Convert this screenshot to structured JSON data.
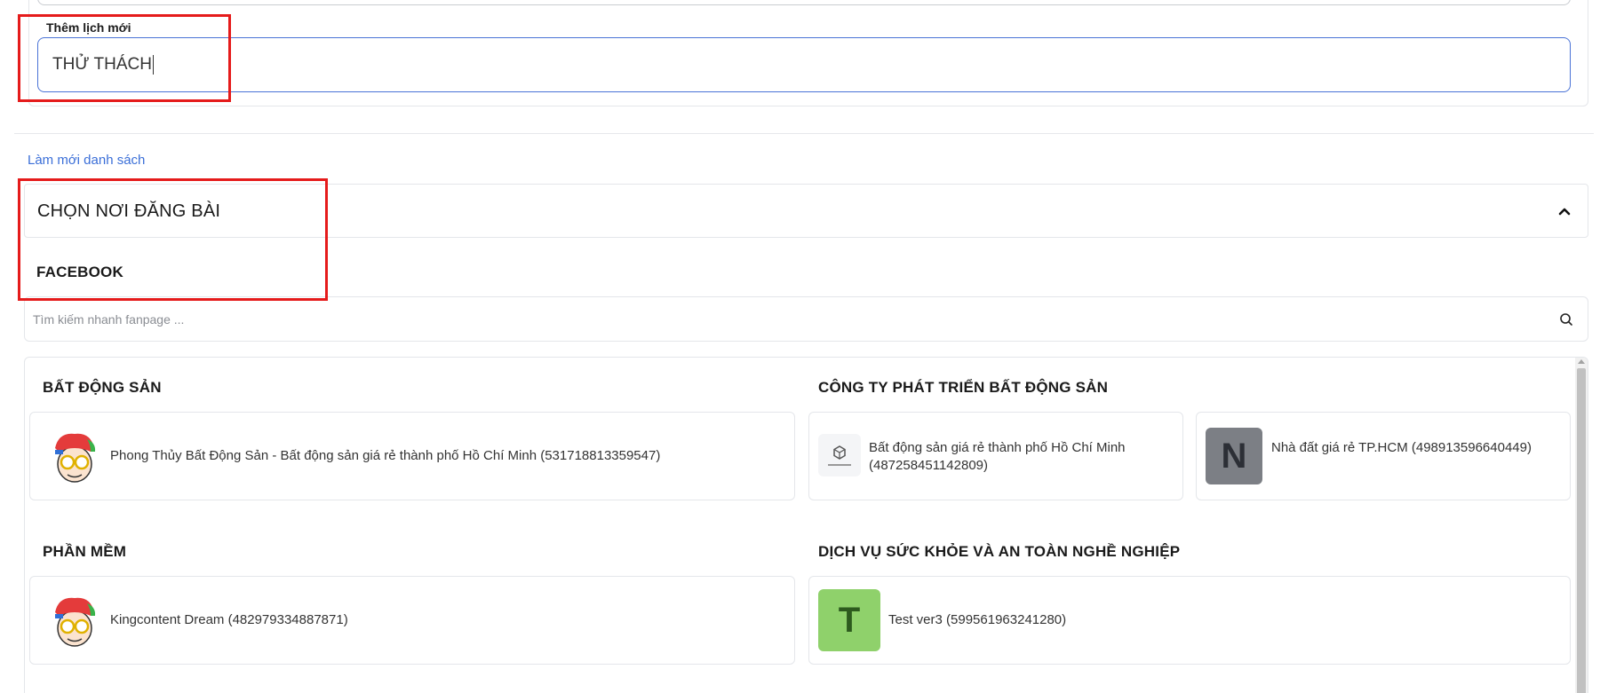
{
  "schedule": {
    "label": "Thêm lịch mới",
    "value": "THỬ THÁCH"
  },
  "refresh_link": "Làm mới danh sách",
  "section": {
    "title": "CHỌN NƠI ĐĂNG BÀI",
    "platform": "FACEBOOK"
  },
  "search": {
    "placeholder": "Tìm kiếm nhanh fanpage ..."
  },
  "categories": [
    {
      "title": "BẤT ĐỘNG SẢN",
      "pages": [
        {
          "name": "Phong Thủy Bất Động Sản - Bất động sản giá rẻ thành phố Hồ Chí Minh (531718813359547)"
        }
      ]
    },
    {
      "title": "CÔNG TY PHÁT TRIỂN BẤT ĐỘNG SẢN",
      "pages": [
        {
          "name": "Bất động sản giá rẻ thành phố Hồ Chí Minh (487258451142809)"
        },
        {
          "name": "Nhà đất giá rẻ TP.HCM (498913596640449)",
          "avatar_letter": "N",
          "avatar_color": "#7c7f85",
          "letter_color": "#2c2f36"
        }
      ]
    },
    {
      "title": "PHẦN MỀM",
      "pages": [
        {
          "name": "Kingcontent Dream (482979334887871)"
        }
      ]
    },
    {
      "title": "DỊCH VỤ SỨC KHỎE VÀ AN TOÀN NGHỀ NGHIỆP",
      "pages": [
        {
          "name": "Test ver3 (599561963241280)",
          "avatar_letter": "T",
          "avatar_color": "#8fd16b",
          "letter_color": "#2d5a1e"
        }
      ]
    }
  ],
  "colors": {
    "accent": "#4a73d6",
    "link": "#3b6fd8",
    "highlight": "#e51b1b"
  }
}
